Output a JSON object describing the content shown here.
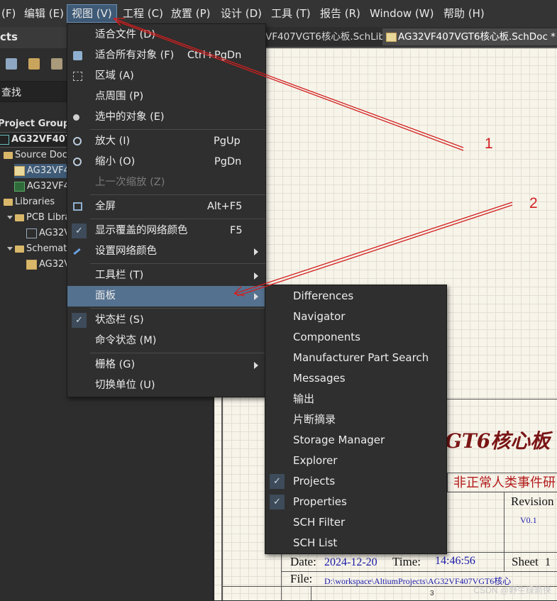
{
  "menubar": {
    "items": [
      "(F)",
      "编辑 (E)",
      "视图 (V)",
      "工程 (C)",
      "放置 (P)",
      "设计 (D)",
      "工具 (T)",
      "报告 (R)",
      "Window (W)",
      "帮助 (H)"
    ]
  },
  "left_panel": {
    "title": "cts",
    "search_label": "查找",
    "tree": [
      {
        "text": "Project Group",
        "level": 0
      },
      {
        "text": "AG32VF407V",
        "level": 0
      },
      {
        "text": "Source Doc",
        "level": 1
      },
      {
        "text": "AG32VF4",
        "level": 2
      },
      {
        "text": "AG32VF4",
        "level": 2
      },
      {
        "text": "Libraries",
        "level": 1
      },
      {
        "text": "PCB Libra",
        "level": 2
      },
      {
        "text": "AG32V",
        "level": 3
      },
      {
        "text": "Schemati",
        "level": 2
      },
      {
        "text": "AG32V",
        "level": 3
      }
    ]
  },
  "tabs": [
    {
      "label": "VF407VGT6核心板.SchLib",
      "active": false
    },
    {
      "label": "AG32VF407VGT6核心板.SchDoc *",
      "active": true
    }
  ],
  "view_menu": {
    "items": [
      {
        "label": "适合文件 (D)",
        "shortcut": "",
        "icon": "fit-document-icon"
      },
      {
        "label": "适合所有对象 (F)",
        "shortcut": "Ctrl+PgDn",
        "icon": "fit-all-objects-icon"
      },
      {
        "label": "区域 (A)",
        "shortcut": "",
        "icon": "area-icon"
      },
      {
        "label": "点周围 (P)",
        "shortcut": "",
        "icon": ""
      },
      {
        "label": "选中的对象 (E)",
        "shortcut": "",
        "icon": "selected-objects-icon"
      },
      {
        "label": "放大 (I)",
        "shortcut": "PgUp",
        "icon": "zoom-in-icon"
      },
      {
        "label": "缩小 (O)",
        "shortcut": "PgDn",
        "icon": "zoom-out-icon"
      },
      {
        "label": "上一次缩放 (Z)",
        "shortcut": "",
        "icon": "",
        "disabled": true
      },
      {
        "label": "全屏",
        "shortcut": "Alt+F5",
        "icon": "fullscreen-icon"
      },
      {
        "label": "显示覆盖的网络颜色",
        "shortcut": "F5",
        "checked": true
      },
      {
        "label": "设置网络颜色",
        "shortcut": "",
        "icon": "pen-icon",
        "submenu": true
      },
      {
        "label": "工具栏 (T)",
        "shortcut": "",
        "submenu": true
      },
      {
        "label": "面板",
        "shortcut": "",
        "submenu": true,
        "highlighted": true
      },
      {
        "label": "状态栏 (S)",
        "shortcut": "",
        "checked": true
      },
      {
        "label": "命令状态 (M)",
        "shortcut": ""
      },
      {
        "label": "栅格 (G)",
        "shortcut": "",
        "submenu": true
      },
      {
        "label": "切换单位 (U)",
        "shortcut": ""
      }
    ]
  },
  "panels_submenu": {
    "items": [
      {
        "label": "Differences",
        "checked": false
      },
      {
        "label": "Navigator",
        "checked": false
      },
      {
        "label": "Components",
        "checked": false
      },
      {
        "label": "Manufacturer Part Search",
        "checked": false
      },
      {
        "label": "Messages",
        "checked": false
      },
      {
        "label": "输出",
        "checked": false
      },
      {
        "label": "片断摘录",
        "checked": false
      },
      {
        "label": "Storage Manager",
        "checked": false
      },
      {
        "label": "Explorer",
        "checked": false
      },
      {
        "label": "Projects",
        "checked": true
      },
      {
        "label": "Properties",
        "checked": true
      },
      {
        "label": "SCH Filter",
        "checked": false
      },
      {
        "label": "SCH List",
        "checked": false
      }
    ]
  },
  "title_block": {
    "title": "GT6核心板",
    "company": "非正常人类事件研",
    "revision_label": "Revision",
    "revision_value": "V0.1",
    "date_label": "Date:",
    "date_value": "2024-12-20",
    "time_label": "Time:",
    "time_value": "14:46:56",
    "sheet_label": "Sheet",
    "sheet_value": "1",
    "file_label": "File:",
    "file_value": "D:\\workspace\\AltiumProjects\\AG32VF407VGT6核心",
    "zone_number": "3"
  },
  "annotations": [
    "1",
    "2"
  ],
  "watermark": "CSDN @野生绿箭侠",
  "colors": {
    "accent": "#54718f",
    "annotation": "#d21f1f",
    "title_red": "#7a1515"
  }
}
